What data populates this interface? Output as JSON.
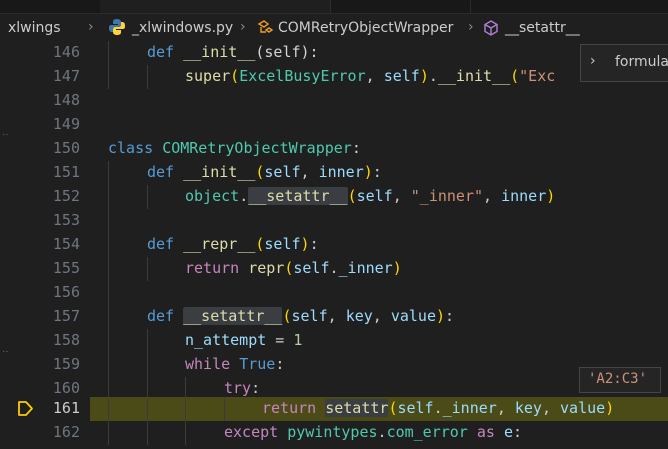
{
  "breadcrumb": {
    "folder": "xlwings",
    "file": "_xlwindows.py",
    "class": "COMRetryObjectWrapper",
    "method": "__setattr__"
  },
  "suggest": {
    "label": "formula"
  },
  "hover_value": "'A2:C3'",
  "lines": [
    {
      "num": "146"
    },
    {
      "num": "147"
    },
    {
      "num": "148"
    },
    {
      "num": "149"
    },
    {
      "num": "150"
    },
    {
      "num": "151"
    },
    {
      "num": "152"
    },
    {
      "num": "153"
    },
    {
      "num": "154"
    },
    {
      "num": "155"
    },
    {
      "num": "156"
    },
    {
      "num": "157"
    },
    {
      "num": "158"
    },
    {
      "num": "159"
    },
    {
      "num": "160"
    },
    {
      "num": "161"
    },
    {
      "num": "162"
    }
  ],
  "code": {
    "l146": {
      "def": "def",
      "name": "__init__",
      "args": "(self):"
    },
    "l147": {
      "super": "super",
      "cls": "ExcelBusyError",
      "self": "self",
      "init": "__init__",
      "str": "\"Exc"
    },
    "l150": {
      "class": "class",
      "name": "COMRetryObjectWrapper",
      "colon": ":"
    },
    "l151": {
      "def": "def",
      "name": "__init__",
      "self": "self",
      "arg": "inner"
    },
    "l152": {
      "obj": "object",
      "method": "__setattr__",
      "self": "self",
      "str": "\"_inner\"",
      "arg": "inner"
    },
    "l154": {
      "def": "def",
      "name": "__repr__",
      "self": "self"
    },
    "l155": {
      "ret": "return",
      "fn": "repr",
      "self": "self",
      "attr": "_inner"
    },
    "l157": {
      "def": "def",
      "name": "__setattr__",
      "self": "self",
      "a1": "key",
      "a2": "value"
    },
    "l158": {
      "var": "n_attempt",
      "val": "1"
    },
    "l159": {
      "kw": "while",
      "val": "True"
    },
    "l160": {
      "kw": "try"
    },
    "l161": {
      "ret": "return",
      "fn": "setattr",
      "self": "self",
      "attr": "_inner",
      "a1": "key",
      "a2": "value"
    },
    "l162": {
      "kw": "except",
      "mod": "pywintypes",
      "attr": "com_error",
      "as": "as",
      "var": "e"
    }
  },
  "colors": {
    "background": "#1f1f1f",
    "current_line": "#4b4b18",
    "debug_arrow": "#ffcc00"
  }
}
